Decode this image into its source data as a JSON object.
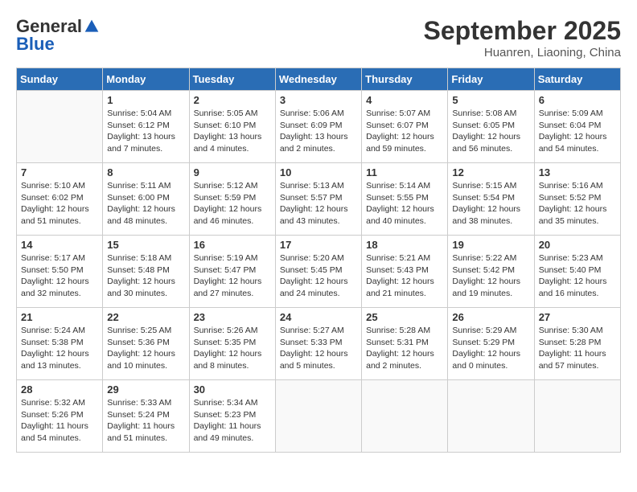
{
  "header": {
    "logo_general": "General",
    "logo_blue": "Blue",
    "month": "September 2025",
    "location": "Huanren, Liaoning, China"
  },
  "weekdays": [
    "Sunday",
    "Monday",
    "Tuesday",
    "Wednesday",
    "Thursday",
    "Friday",
    "Saturday"
  ],
  "weeks": [
    [
      {
        "day": "",
        "info": ""
      },
      {
        "day": "1",
        "info": "Sunrise: 5:04 AM\nSunset: 6:12 PM\nDaylight: 13 hours\nand 7 minutes."
      },
      {
        "day": "2",
        "info": "Sunrise: 5:05 AM\nSunset: 6:10 PM\nDaylight: 13 hours\nand 4 minutes."
      },
      {
        "day": "3",
        "info": "Sunrise: 5:06 AM\nSunset: 6:09 PM\nDaylight: 13 hours\nand 2 minutes."
      },
      {
        "day": "4",
        "info": "Sunrise: 5:07 AM\nSunset: 6:07 PM\nDaylight: 12 hours\nand 59 minutes."
      },
      {
        "day": "5",
        "info": "Sunrise: 5:08 AM\nSunset: 6:05 PM\nDaylight: 12 hours\nand 56 minutes."
      },
      {
        "day": "6",
        "info": "Sunrise: 5:09 AM\nSunset: 6:04 PM\nDaylight: 12 hours\nand 54 minutes."
      }
    ],
    [
      {
        "day": "7",
        "info": "Sunrise: 5:10 AM\nSunset: 6:02 PM\nDaylight: 12 hours\nand 51 minutes."
      },
      {
        "day": "8",
        "info": "Sunrise: 5:11 AM\nSunset: 6:00 PM\nDaylight: 12 hours\nand 48 minutes."
      },
      {
        "day": "9",
        "info": "Sunrise: 5:12 AM\nSunset: 5:59 PM\nDaylight: 12 hours\nand 46 minutes."
      },
      {
        "day": "10",
        "info": "Sunrise: 5:13 AM\nSunset: 5:57 PM\nDaylight: 12 hours\nand 43 minutes."
      },
      {
        "day": "11",
        "info": "Sunrise: 5:14 AM\nSunset: 5:55 PM\nDaylight: 12 hours\nand 40 minutes."
      },
      {
        "day": "12",
        "info": "Sunrise: 5:15 AM\nSunset: 5:54 PM\nDaylight: 12 hours\nand 38 minutes."
      },
      {
        "day": "13",
        "info": "Sunrise: 5:16 AM\nSunset: 5:52 PM\nDaylight: 12 hours\nand 35 minutes."
      }
    ],
    [
      {
        "day": "14",
        "info": "Sunrise: 5:17 AM\nSunset: 5:50 PM\nDaylight: 12 hours\nand 32 minutes."
      },
      {
        "day": "15",
        "info": "Sunrise: 5:18 AM\nSunset: 5:48 PM\nDaylight: 12 hours\nand 30 minutes."
      },
      {
        "day": "16",
        "info": "Sunrise: 5:19 AM\nSunset: 5:47 PM\nDaylight: 12 hours\nand 27 minutes."
      },
      {
        "day": "17",
        "info": "Sunrise: 5:20 AM\nSunset: 5:45 PM\nDaylight: 12 hours\nand 24 minutes."
      },
      {
        "day": "18",
        "info": "Sunrise: 5:21 AM\nSunset: 5:43 PM\nDaylight: 12 hours\nand 21 minutes."
      },
      {
        "day": "19",
        "info": "Sunrise: 5:22 AM\nSunset: 5:42 PM\nDaylight: 12 hours\nand 19 minutes."
      },
      {
        "day": "20",
        "info": "Sunrise: 5:23 AM\nSunset: 5:40 PM\nDaylight: 12 hours\nand 16 minutes."
      }
    ],
    [
      {
        "day": "21",
        "info": "Sunrise: 5:24 AM\nSunset: 5:38 PM\nDaylight: 12 hours\nand 13 minutes."
      },
      {
        "day": "22",
        "info": "Sunrise: 5:25 AM\nSunset: 5:36 PM\nDaylight: 12 hours\nand 10 minutes."
      },
      {
        "day": "23",
        "info": "Sunrise: 5:26 AM\nSunset: 5:35 PM\nDaylight: 12 hours\nand 8 minutes."
      },
      {
        "day": "24",
        "info": "Sunrise: 5:27 AM\nSunset: 5:33 PM\nDaylight: 12 hours\nand 5 minutes."
      },
      {
        "day": "25",
        "info": "Sunrise: 5:28 AM\nSunset: 5:31 PM\nDaylight: 12 hours\nand 2 minutes."
      },
      {
        "day": "26",
        "info": "Sunrise: 5:29 AM\nSunset: 5:29 PM\nDaylight: 12 hours\nand 0 minutes."
      },
      {
        "day": "27",
        "info": "Sunrise: 5:30 AM\nSunset: 5:28 PM\nDaylight: 11 hours\nand 57 minutes."
      }
    ],
    [
      {
        "day": "28",
        "info": "Sunrise: 5:32 AM\nSunset: 5:26 PM\nDaylight: 11 hours\nand 54 minutes."
      },
      {
        "day": "29",
        "info": "Sunrise: 5:33 AM\nSunset: 5:24 PM\nDaylight: 11 hours\nand 51 minutes."
      },
      {
        "day": "30",
        "info": "Sunrise: 5:34 AM\nSunset: 5:23 PM\nDaylight: 11 hours\nand 49 minutes."
      },
      {
        "day": "",
        "info": ""
      },
      {
        "day": "",
        "info": ""
      },
      {
        "day": "",
        "info": ""
      },
      {
        "day": "",
        "info": ""
      }
    ]
  ]
}
